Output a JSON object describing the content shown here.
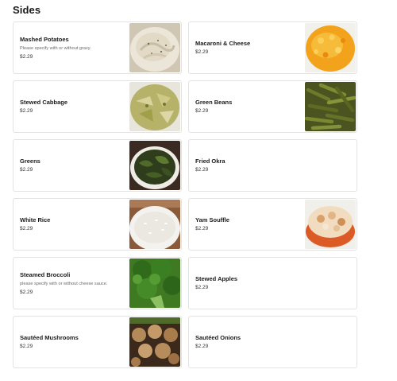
{
  "section": {
    "title": "Sides"
  },
  "items": [
    {
      "name": "Mashed Potatoes",
      "description": "Please specify with or without gravy.",
      "price": "$2.29",
      "image": "mashed-potatoes-photo"
    },
    {
      "name": "Macaroni & Cheese",
      "description": "",
      "price": "$2.29",
      "image": "macaroni-cheese-photo"
    },
    {
      "name": "Stewed Cabbage",
      "description": "",
      "price": "$2.29",
      "image": "stewed-cabbage-photo"
    },
    {
      "name": "Green Beans",
      "description": "",
      "price": "$2.29",
      "image": "green-beans-photo"
    },
    {
      "name": "Greens",
      "description": "",
      "price": "$2.29",
      "image": "greens-photo"
    },
    {
      "name": "Fried Okra",
      "description": "",
      "price": "$2.29",
      "image": ""
    },
    {
      "name": "White Rice",
      "description": "",
      "price": "$2.29",
      "image": "white-rice-photo"
    },
    {
      "name": "Yam Souffle",
      "description": "",
      "price": "$2.29",
      "image": "yam-souffle-photo"
    },
    {
      "name": "Steamed Broccoli",
      "description": "please specify with or without cheese sauce.",
      "price": "$2.29",
      "image": "steamed-broccoli-photo"
    },
    {
      "name": "Stewed Apples",
      "description": "",
      "price": "$2.29",
      "image": ""
    },
    {
      "name": "Sautéed Mushrooms",
      "description": "",
      "price": "$2.29",
      "image": "sauteed-mushrooms-photo"
    },
    {
      "name": "Sautéed Onions",
      "description": "",
      "price": "$2.29",
      "image": ""
    }
  ]
}
